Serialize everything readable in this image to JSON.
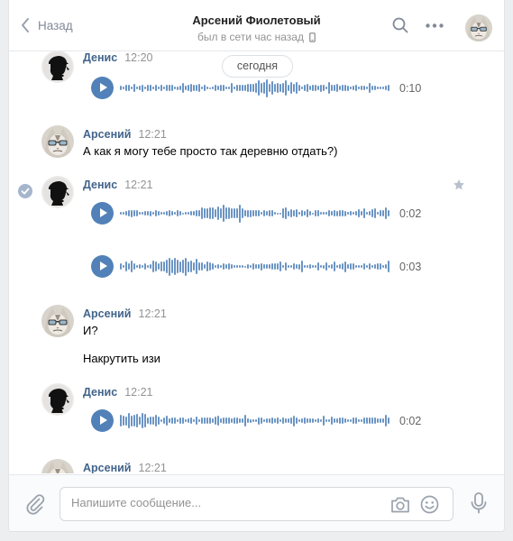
{
  "header": {
    "back_label": "Назад",
    "title": "Арсений Фиолетовый",
    "subtitle": "был в сети час назад"
  },
  "date_separator": "сегодня",
  "messages": [
    {
      "author": "Денис",
      "time": "12:20",
      "voice": [
        {
          "duration": "0:10"
        }
      ]
    },
    {
      "author": "Арсений",
      "time": "12:21",
      "lines": [
        "А как я могу тебе просто так деревню отдать?)"
      ]
    },
    {
      "author": "Денис",
      "time": "12:21",
      "voice": [
        {
          "duration": "0:02"
        },
        {
          "duration": "0:03"
        }
      ]
    },
    {
      "author": "Арсений",
      "time": "12:21",
      "lines": [
        "И?",
        "Накрутить изи"
      ]
    },
    {
      "author": "Денис",
      "time": "12:21",
      "voice": [
        {
          "duration": "0:02"
        }
      ]
    },
    {
      "author": "Арсений",
      "time": "12:21"
    }
  ],
  "composer": {
    "placeholder": "Напишите сообщение..."
  },
  "colors": {
    "accent": "#5181b8",
    "name": "#42648b",
    "background": "#edeef0"
  }
}
